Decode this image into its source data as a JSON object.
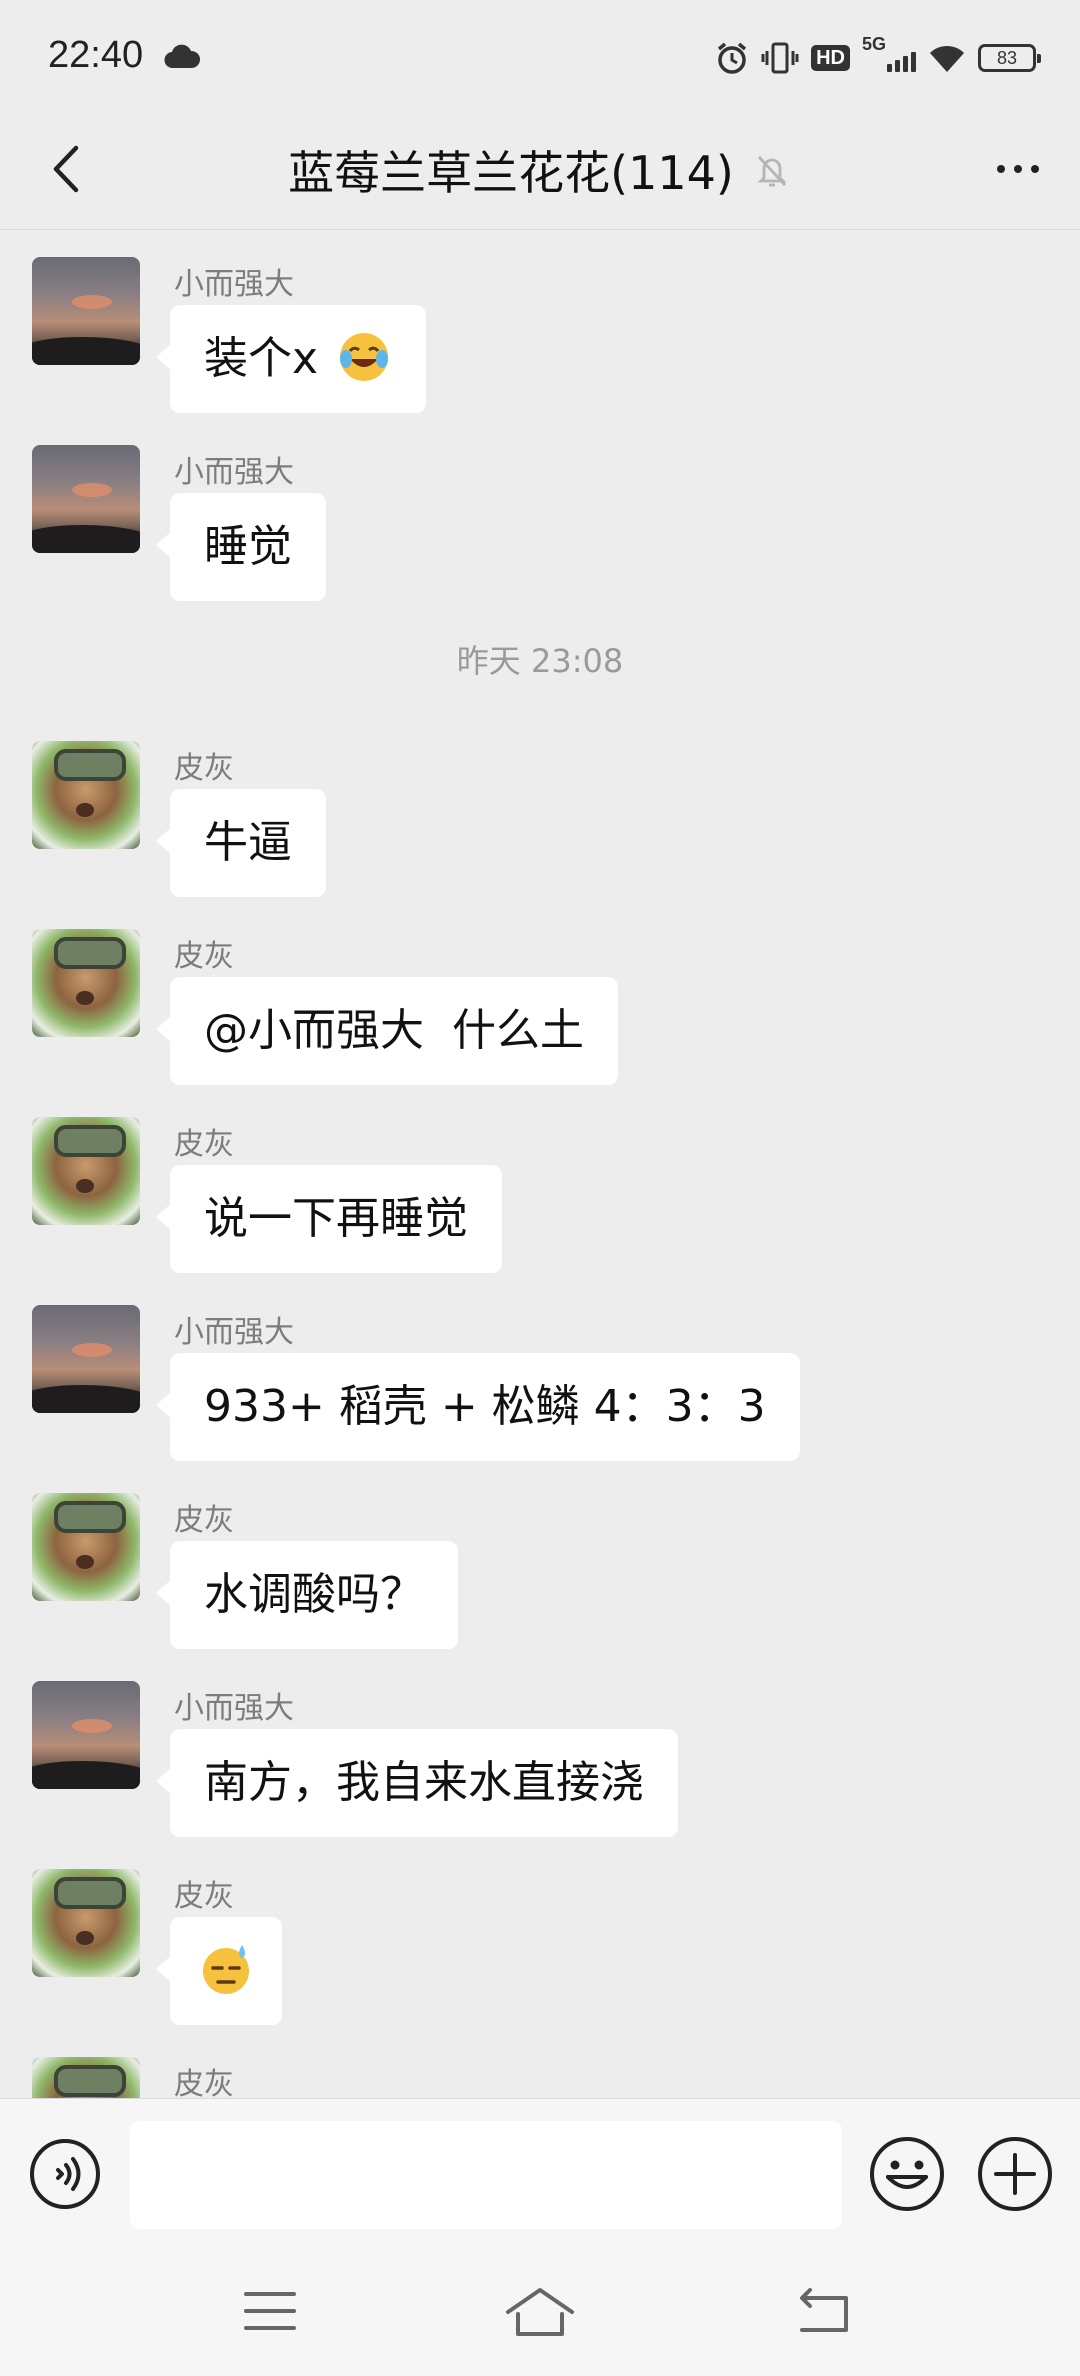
{
  "status_bar": {
    "time": "22:40",
    "network": "5G",
    "hd_label": "HD",
    "battery": "83"
  },
  "header": {
    "title": "蓝莓兰草兰花花(114)"
  },
  "messages": [
    {
      "type": "msg",
      "sender": "小而强大",
      "avatar": "sunset",
      "text": "装个x",
      "emoji": "face-with-tears-of-joy"
    },
    {
      "type": "msg",
      "sender": "小而强大",
      "avatar": "sunset",
      "text": "睡觉"
    },
    {
      "type": "time",
      "text": "昨天 23:08"
    },
    {
      "type": "msg",
      "sender": "皮灰",
      "avatar": "teemo",
      "text": "牛逼"
    },
    {
      "type": "msg",
      "sender": "皮灰",
      "avatar": "teemo",
      "text": "@小而强大  什么土"
    },
    {
      "type": "msg",
      "sender": "皮灰",
      "avatar": "teemo",
      "text": "说一下再睡觉"
    },
    {
      "type": "msg",
      "sender": "小而强大",
      "avatar": "sunset",
      "text": "933+ 稻壳 + 松鳞 4：3：3"
    },
    {
      "type": "msg",
      "sender": "皮灰",
      "avatar": "teemo",
      "text": "水调酸吗？"
    },
    {
      "type": "msg",
      "sender": "小而强大",
      "avatar": "sunset",
      "text": "南方，我自来水直接浇"
    },
    {
      "type": "msg",
      "sender": "皮灰",
      "avatar": "teemo",
      "text": "",
      "emoji": "sweat-face"
    },
    {
      "type": "msg",
      "sender": "皮灰",
      "avatar": "teemo",
      "text": ""
    }
  ],
  "input": {
    "value": "",
    "placeholder": ""
  },
  "icons": {
    "back": "chevron-left-icon",
    "mute": "bell-off-icon",
    "more": "more-dots-icon",
    "voice": "voice-icon",
    "emoji": "smiley-icon",
    "plus": "plus-icon",
    "nav_menu": "menu-icon",
    "nav_home": "home-icon",
    "nav_back": "back-icon"
  },
  "colors": {
    "background": "#ededed",
    "bubble": "#ffffff",
    "sender": "#7d7d7d",
    "timestamp": "#9a9a9a"
  }
}
